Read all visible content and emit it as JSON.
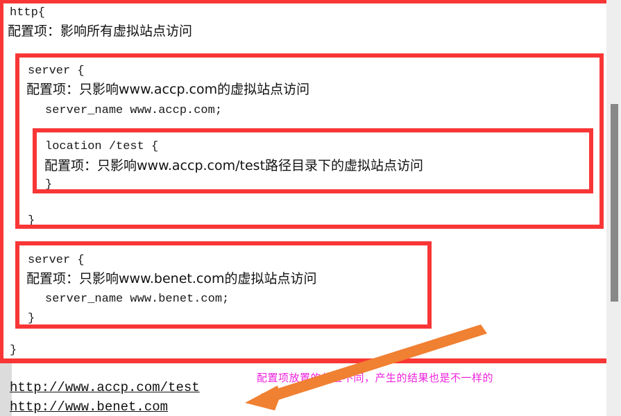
{
  "document": {
    "type": "nginx-configuration-annotated",
    "code_lines": [
      {
        "id": "http_open",
        "text": "http{"
      },
      {
        "id": "http_comment",
        "text": "配置项：影响所有虚拟站点访问"
      },
      {
        "id": "server_accp_open",
        "text": "server {"
      },
      {
        "id": "server_accp_comment",
        "text": "配置项：只影响www.accp.com的虚拟站点访问"
      },
      {
        "id": "server_accp_name",
        "text": "server_name   www.accp.com;"
      },
      {
        "id": "location_open",
        "text": "location /test {"
      },
      {
        "id": "location_comment",
        "text": "配置项：只影响www.accp.com/test路径目录下的虚拟站点访问"
      },
      {
        "id": "location_close",
        "text": "}"
      },
      {
        "id": "server_accp_close",
        "text": "}"
      },
      {
        "id": "server_benet_open",
        "text": "server {"
      },
      {
        "id": "server_benet_comment",
        "text": "配置项：只影响www.benet.com的虚拟站点访问"
      },
      {
        "id": "server_benet_name",
        "text": "server_name   www.benet.com;"
      },
      {
        "id": "server_benet_close",
        "text": "}"
      },
      {
        "id": "http_close",
        "text": "}"
      }
    ],
    "links": [
      {
        "id": "link-accp-test",
        "text": "http://www.accp.com/test"
      },
      {
        "id": "link-benet",
        "text": "http://www.benet.com"
      }
    ],
    "annotation": {
      "text": "配置项放置的位置不同，产生的结果也是不一样的",
      "color": "#ee22dd"
    },
    "highlight_boxes": [
      {
        "id": "box-http",
        "label": "http-block-highlight"
      },
      {
        "id": "box-server-accp",
        "label": "server-accp-block-highlight"
      },
      {
        "id": "box-location",
        "label": "location-test-block-highlight"
      },
      {
        "id": "box-server-benet",
        "label": "server-benet-block-highlight"
      }
    ],
    "colors": {
      "highlight_red": "#f93636",
      "arrow_orange": "#f08032",
      "annotation_magenta": "#ee22dd",
      "scrollbar_track": "#eeeeee",
      "scrollbar_thumb": "#888888",
      "page_background": "#ffffff"
    }
  },
  "arrow": {
    "name": "pointer-arrow",
    "from": "690,472",
    "to": "355,582",
    "color": "#f08032"
  }
}
